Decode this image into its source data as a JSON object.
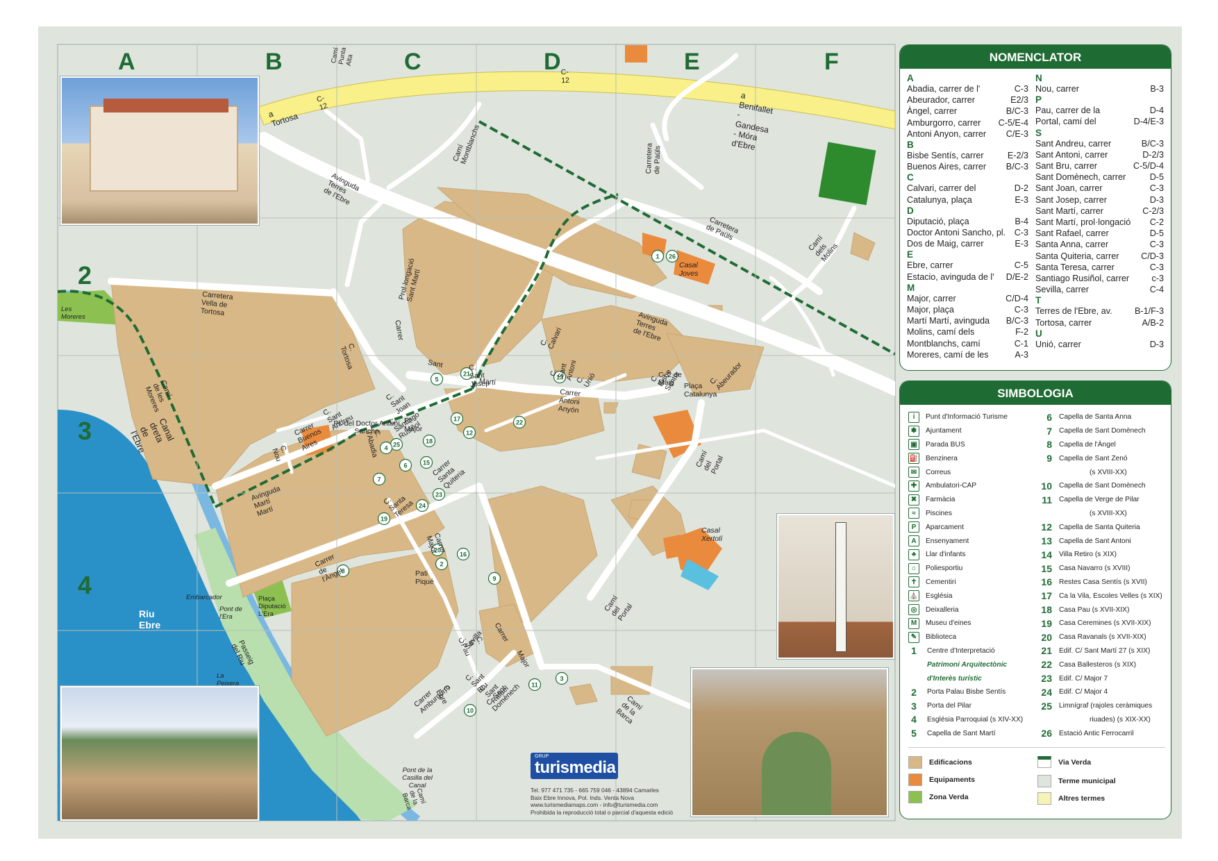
{
  "grid": {
    "columns": [
      "A",
      "B",
      "C",
      "D",
      "E",
      "F"
    ],
    "rows": [
      "2",
      "3",
      "4"
    ]
  },
  "roads": {
    "c12_a": "C-12",
    "c12_b": "C-12",
    "a_tortosa": "a Tortosa",
    "c12_c": "C-12",
    "benifallet": "a Benifallet - Gandesa - Móra d'Ebre",
    "cami_punta_alta": "Camí Punta Alta",
    "cami_montblanchs": "Camí Montblanchs",
    "carretera_paulis": "Carretera de Paüls",
    "carretera_paulis2": "Carretera de Paüls",
    "cami_molins": "Camí dels Molins",
    "av_terres_1": "Avinguda Terres de l'Ebre",
    "av_terres_2": "Avinguda Terres de l'Ebre",
    "carretera_vella": "Carretera Vella de Tortosa",
    "prol_sant_marti": "Prol·longació Sant Martí",
    "carrer": "Carrer",
    "marti_rector": "Marti Martí",
    "c_tortosa": "C. Tortosa",
    "c_sant_josep": "C. Sant Josep",
    "sant": "Sant",
    "marti": "Martí",
    "carrer_antoni_anyon": "Carrer Antoni Anyón",
    "c_sant_antoni": "C. Sant Antoni",
    "c_unio": "C. Unió",
    "c_calvari": "C. Calvari",
    "c_bisbe_sentis": "C. Bisbe Sentís",
    "c_2_de_maig": "C. 2 de Maig",
    "placa_catalunya": "Plaça Catalunya",
    "c_abeurador": "C. Abeurador",
    "c_sant_andreu": "C. Sant Andreu",
    "carrer_buenos_aires": "Carrer Buenos Aires",
    "c_sant_joan": "C. Sant Joan",
    "c_santiago_rusinol": "C. Santiago Rusiñol",
    "pl_major": "Pl. Major",
    "pl_doctor": "Pl. del Doctor Antoni Sancho",
    "c_nou": "C. Nou",
    "av_marti": "Avinguda Martí Martí",
    "cami_moreres": "Camí de les Moreres",
    "canal_dreta": "Canal dreta de l'Ebre",
    "c_santa_quiteria": "Carrer Santa Quiteria",
    "c_abadia": "C. l'Abadia",
    "c_santa_teresa": "C. Santa Teresa",
    "carrer_angel": "Carrer de l'Àngel",
    "pati_pique": "Pati Piqué",
    "carrer_major": "Carrer Major",
    "cami_portal": "Camí del Portal",
    "cami_portal2": "Camí del Portal",
    "casal_xertoli": "Casal Xertolí",
    "casal_joves": "Casal Joves",
    "c_sevilla": "C. Sevilla",
    "c_la_pau": "C. la Pau",
    "c_sant_bru": "C. Sant Bru",
    "c_sant_rafael": "C. Sant Rafael",
    "c_sant_domenech": "C. Sant Domènech",
    "c_ebre": "C. Ebre",
    "carrer_amburgorro": "Carrer Amburgorro",
    "carrer2": "Carrer",
    "major2": "Major",
    "cami_barca": "Camí de la Barca",
    "les_moreres": "Les Moreres",
    "riu_ebre": "Riu Ebre",
    "embarcador": "Embarcador",
    "pont_era": "Pont de l'Era",
    "placa_diputacio": "Plaça Diputació L'Era",
    "passeig_riu": "Passeig del Riu",
    "la_peixera": "La Peixera",
    "pont_casilla": "Pont de la Casilla del Canal",
    "cami_barca2": "Camí de la Barca"
  },
  "nomenclator": {
    "title": "NOMENCLATOR",
    "left": [
      {
        "letter": "A"
      },
      {
        "name": "Abadia, carrer de l'",
        "code": "C-3"
      },
      {
        "name": "Abeurador, carrer",
        "code": "E2/3"
      },
      {
        "name": "Àngel, carrer",
        "code": "B/C-3"
      },
      {
        "name": "Amburgorro, carrer",
        "code": "C-5/E-4"
      },
      {
        "name": "Antoni Anyon, carrer",
        "code": "C/E-3"
      },
      {
        "letter": "B"
      },
      {
        "name": "Bisbe Sentís, carrer",
        "code": "E-2/3"
      },
      {
        "name": "Buenos Aires, carrer",
        "code": "B/C-3"
      },
      {
        "letter": "C"
      },
      {
        "name": "Calvari, carrer del",
        "code": "D-2"
      },
      {
        "name": "Catalunya, plaça",
        "code": "E-3"
      },
      {
        "letter": "D"
      },
      {
        "name": "Diputació, plaça",
        "code": "B-4"
      },
      {
        "name": "Doctor Antoni Sancho, pl.",
        "code": "C-3"
      },
      {
        "name": "Dos de Maig, carrer",
        "code": "E-3"
      },
      {
        "letter": "E"
      },
      {
        "name": "Ebre, carrer",
        "code": "C-5"
      },
      {
        "name": "Estacio, avinguda de l'",
        "code": "D/E-2"
      },
      {
        "letter": "M"
      },
      {
        "name": "Major, carrer",
        "code": "C/D-4"
      },
      {
        "name": "Major, plaça",
        "code": "C-3"
      },
      {
        "name": "Martí Martí, avinguda",
        "code": "B/C-3"
      },
      {
        "name": "Molins, camí dels",
        "code": "F-2"
      },
      {
        "name": "Montblanchs, camí",
        "code": "C-1"
      },
      {
        "name": "Moreres, camí de les",
        "code": "A-3"
      }
    ],
    "right": [
      {
        "letter": "N"
      },
      {
        "name": "Nou, carrer",
        "code": "B-3"
      },
      {
        "letter": "P"
      },
      {
        "name": "Pau, carrer de la",
        "code": "D-4"
      },
      {
        "name": "Portal, camí del",
        "code": "D-4/E-3"
      },
      {
        "letter": "S"
      },
      {
        "name": "Sant Andreu, carrer",
        "code": "B/C-3"
      },
      {
        "name": "Sant Antoni, carrer",
        "code": "D-2/3"
      },
      {
        "name": "Sant Bru, carrer",
        "code": "C-5/D-4"
      },
      {
        "name": "Sant Domènech, carrer",
        "code": "D-5"
      },
      {
        "name": "Sant Joan, carrer",
        "code": "C-3"
      },
      {
        "name": "Sant Josep, carrer",
        "code": "D-3"
      },
      {
        "name": "Sant Martí, carrer",
        "code": "C-2/3"
      },
      {
        "name": "Sant Martí, prol·longació",
        "code": "C-2"
      },
      {
        "name": "Sant Rafael, carrer",
        "code": "D-5"
      },
      {
        "name": "Santa Anna, carrer",
        "code": "C-3"
      },
      {
        "name": "Santa Quiteria, carrer",
        "code": "C/D-3"
      },
      {
        "name": "Santa Teresa, carrer",
        "code": "C-3"
      },
      {
        "name": "Santiago Rusiñol, carrer",
        "code": "c-3"
      },
      {
        "name": "Sevilla, carrer",
        "code": "C-4"
      },
      {
        "letter": "T"
      },
      {
        "name": "Terres de l'Ebre, av.",
        "code": "B-1/F-3"
      },
      {
        "name": "Tortosa, carrer",
        "code": "A/B-2"
      },
      {
        "letter": "U"
      },
      {
        "name": "Unió, carrer",
        "code": "D-3"
      }
    ]
  },
  "simbologia": {
    "title": "SIMBOLOGIA",
    "left": [
      {
        "icon": "info-icon",
        "glyph": "i",
        "label": "Punt d'Informació Turisme"
      },
      {
        "icon": "town-hall-icon",
        "glyph": "✽",
        "label": "Ajuntament"
      },
      {
        "icon": "bus-icon",
        "glyph": "▣",
        "label": "Parada BUS"
      },
      {
        "icon": "fuel-icon",
        "glyph": "⛽",
        "label": "Benzinera"
      },
      {
        "icon": "post-icon",
        "glyph": "✉",
        "label": "Correus"
      },
      {
        "icon": "medical-icon",
        "glyph": "✚",
        "label": "Ambulatori-CAP"
      },
      {
        "icon": "pharmacy-icon",
        "glyph": "✖",
        "label": "Farmàcia"
      },
      {
        "icon": "pool-icon",
        "glyph": "≈",
        "label": "Piscines"
      },
      {
        "icon": "parking-icon",
        "glyph": "P",
        "label": "Aparcament"
      },
      {
        "icon": "school-icon",
        "glyph": "A",
        "label": "Ensenyament"
      },
      {
        "icon": "nursery-icon",
        "glyph": "♣",
        "label": "Llar d'infants"
      },
      {
        "icon": "sports-icon",
        "glyph": "⌂",
        "label": "Poliesportiu"
      },
      {
        "icon": "cemetery-icon",
        "glyph": "✝",
        "label": "Cementiri"
      },
      {
        "icon": "church-icon",
        "glyph": "⛪",
        "label": "Església"
      },
      {
        "icon": "recycling-icon",
        "glyph": "◎",
        "label": "Deixalleria"
      },
      {
        "icon": "museum-icon",
        "glyph": "M",
        "label": "Museu d'eines"
      },
      {
        "icon": "library-icon",
        "glyph": "✎",
        "label": "Biblioteca"
      },
      {
        "num": "1",
        "label": "Centre d'Interpretació"
      },
      {
        "italic": "Patrimoni Arquitectònic"
      },
      {
        "italic": "d'Interès turístic"
      },
      {
        "num": "2",
        "label": "Porta Palau Bisbe Sentís"
      },
      {
        "num": "3",
        "label": "Porta del Pilar"
      },
      {
        "num": "4",
        "label": "Església Parroquial (s XIV-XX)"
      },
      {
        "num": "5",
        "label": "Capella de Sant Martí"
      }
    ],
    "right": [
      {
        "num": "6",
        "label": "Capella de Santa Anna"
      },
      {
        "num": "7",
        "label": "Capella de Sant Domènech"
      },
      {
        "num": "8",
        "label": "Capella de l'Àngel"
      },
      {
        "num": "9",
        "label": "Capella de Sant Zenó"
      },
      {
        "label": "(s XVIII-XX)",
        "indent": true
      },
      {
        "num": "10",
        "label": "Capella de Sant Domènech"
      },
      {
        "num": "11",
        "label": "Capella de Verge de Pilar"
      },
      {
        "label": "(s XVIII-XX)",
        "indent": true
      },
      {
        "num": "12",
        "label": "Capella de Santa Quiteria"
      },
      {
        "num": "13",
        "label": "Capella de Sant Antoni"
      },
      {
        "num": "14",
        "label": "Villa Retiro (s XIX)"
      },
      {
        "num": "15",
        "label": "Casa Navarro (s XVIII)"
      },
      {
        "num": "16",
        "label": "Restes Casa Sentís (s XVII)"
      },
      {
        "num": "17",
        "label": "Ca la Vila, Escoles Velles (s XIX)"
      },
      {
        "num": "18",
        "label": "Casa Pau (s XVII-XIX)"
      },
      {
        "num": "19",
        "label": "Casa Ceremines (s XVII-XIX)"
      },
      {
        "num": "20",
        "label": "Casa Ravanals (s XVII-XIX)"
      },
      {
        "num": "21",
        "label": "Edif. C/ Sant Martí 27 (s XIX)"
      },
      {
        "num": "22",
        "label": "Casa Ballesteros (s XIX)"
      },
      {
        "num": "23",
        "label": "Edif. C/ Major 7"
      },
      {
        "num": "24",
        "label": "Edif. C/ Major 4"
      },
      {
        "num": "25",
        "label": "Limnígraf (rajoles ceràmiques"
      },
      {
        "label": "riuades) (s XIX-XX)",
        "indent": true
      },
      {
        "num": "26",
        "label": "Estació Antic Ferrocarril"
      }
    ],
    "legend": {
      "edificacions": "Edificacions",
      "equipaments": "Equipaments",
      "zona_verda": "Zona Verda",
      "via_verda": "Via Verda",
      "terme": "Terme municipal",
      "altres": "Altres termes"
    }
  },
  "colors": {
    "edificacions": "#d9b887",
    "equipaments": "#ea8a3c",
    "zona_verda": "#8cc152",
    "terme": "#dfe4dd",
    "altres": "#f6f3b8",
    "river": "#2a90c8",
    "canal": "#7ab8e2",
    "green_dark": "#1f6b34",
    "road_yellow": "#f9f08a"
  },
  "markers": [
    "1",
    "26",
    "5",
    "21",
    "13",
    "25",
    "17",
    "12",
    "18",
    "4",
    "6",
    "15",
    "22",
    "7",
    "24",
    "23",
    "19",
    "8",
    "20",
    "2",
    "16",
    "9",
    "11",
    "3",
    "10"
  ],
  "logo": {
    "small": "GRUP",
    "brand": "turismedia"
  },
  "credits": {
    "line1": "Tel. 977 471 735 - 665 759 046 - 43894 Camarles",
    "line2": "Baix Ebre Innova, Pol. Inds. Venta Nova",
    "line3": "www.turismediamaps.com - info@turismedia.com",
    "line4": "Prohibida la reproducció total o parcial d'aquesta edició"
  }
}
